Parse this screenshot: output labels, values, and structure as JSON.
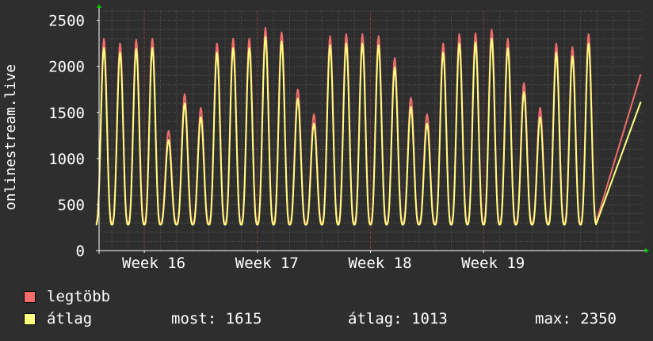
{
  "colors": {
    "background": "#2e2e2e",
    "plot_background": "#2e2e2e",
    "grid": "#5a5a5a",
    "grid_major": "#8a2e2e",
    "axis": "#ffffff",
    "arrow": "#00cc00",
    "max_series": "#f26c6c",
    "avg_series": "#ffff80"
  },
  "legend": {
    "max_label": "legtöbb",
    "avg_label": "átlag",
    "stats": [
      {
        "label": "most:",
        "value": "1615"
      },
      {
        "label": "átlag:",
        "value": "1013"
      },
      {
        "label": "max:",
        "value": "2350"
      }
    ]
  },
  "chart_data": {
    "type": "line",
    "ylabel": "onlinestream.live",
    "ylim": [
      0,
      2600
    ],
    "yticks": [
      0,
      500,
      1000,
      1500,
      2000,
      2500
    ],
    "xlim": [
      15.6,
      20.4
    ],
    "xticks": [
      {
        "x": 16,
        "label": "Week 16"
      },
      {
        "x": 17,
        "label": "Week 17"
      },
      {
        "x": 18,
        "label": "Week 18"
      },
      {
        "x": 19,
        "label": "Week 19"
      }
    ],
    "grid": true,
    "days_per_week": 7,
    "day_min_avg": 280,
    "day_peaks_avg": [
      2200,
      2150,
      2190,
      2200,
      1200,
      1600,
      1450,
      2150,
      2200,
      2200,
      2320,
      2270,
      1650,
      1380,
      2230,
      2250,
      2250,
      2230,
      1990,
      1560,
      1380,
      2150,
      2250,
      2260,
      2300,
      2200,
      1720,
      1450,
      2150,
      2110,
      2250
    ],
    "max_offset": 80,
    "current_value": 1615,
    "series": [
      {
        "name": "legtöbb",
        "key": "max"
      },
      {
        "name": "átlag",
        "key": "avg"
      }
    ]
  }
}
